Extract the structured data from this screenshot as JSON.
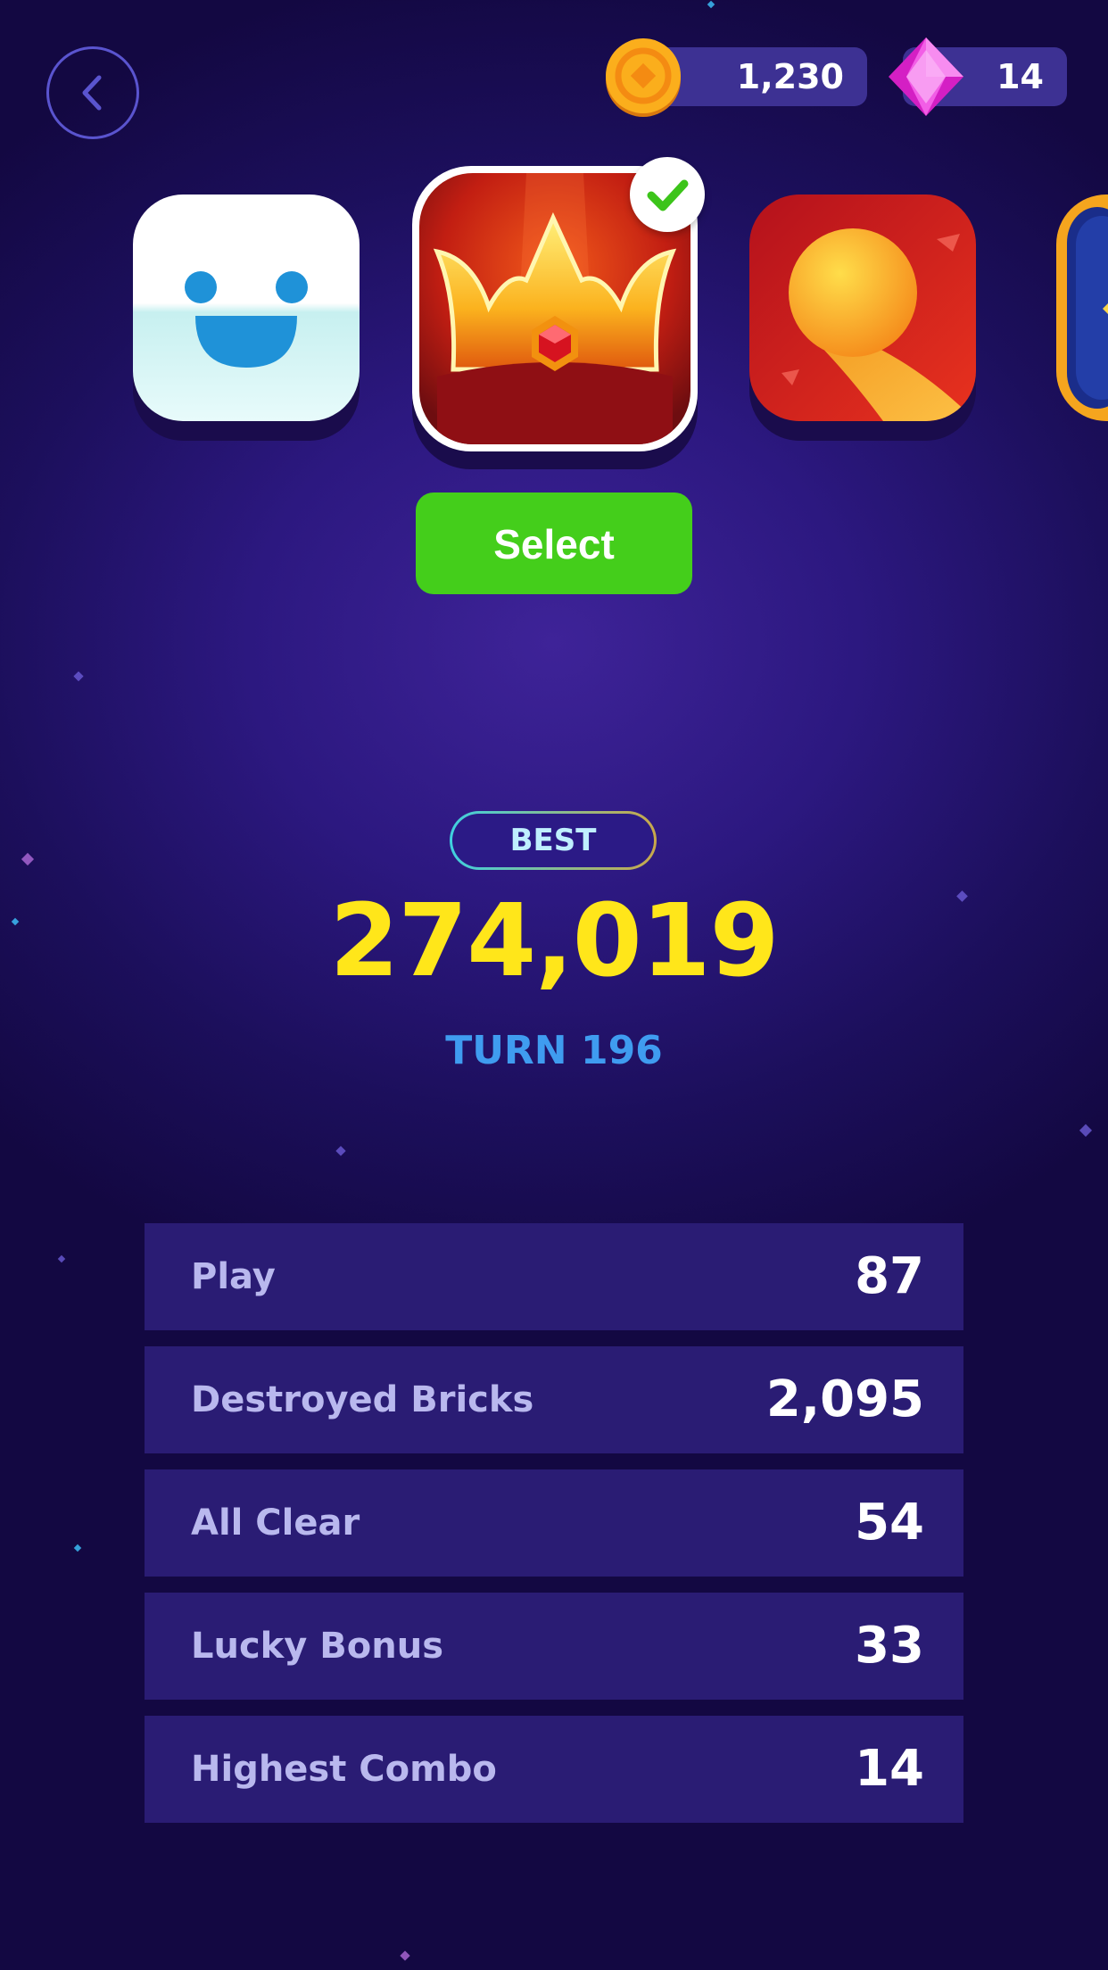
{
  "header": {
    "back_icon": "chevron-left-icon",
    "coins": {
      "icon": "coin-icon",
      "value": "1,230"
    },
    "gems": {
      "icon": "gem-icon",
      "value": "14"
    }
  },
  "themes": {
    "items": [
      "smiley-face-theme",
      "crown-theme",
      "fire-ball-theme",
      "gold-frame-theme"
    ],
    "selected_index": 1,
    "selected_icon": "checkmark-icon"
  },
  "select_button": {
    "label": "Select"
  },
  "best": {
    "badge": "BEST",
    "score": "274,019",
    "turn": "TURN 196"
  },
  "stats": [
    {
      "label": "Play",
      "value": "87"
    },
    {
      "label": "Destroyed Bricks",
      "value": "2,095"
    },
    {
      "label": "All Clear",
      "value": "54"
    },
    {
      "label": "Lucky Bonus",
      "value": "33"
    },
    {
      "label": "Highest Combo",
      "value": "14"
    }
  ],
  "colors": {
    "background": "#2c1880",
    "accent_green": "#44ce1b",
    "score_yellow": "#ffe61a",
    "turn_blue": "#3f9cf0",
    "row_bg": "#2a1c74"
  }
}
